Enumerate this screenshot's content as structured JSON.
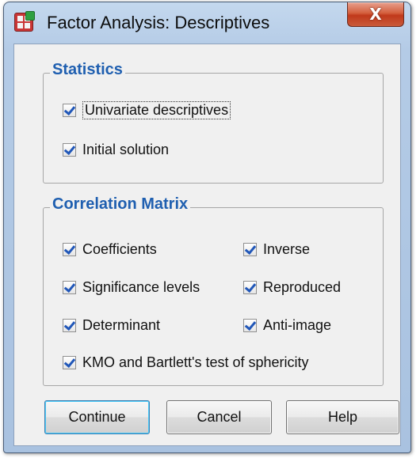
{
  "window": {
    "title": "Factor Analysis: Descriptives",
    "close_label": "X"
  },
  "statistics": {
    "legend": "Statistics",
    "items": [
      {
        "label": "Univariate descriptives",
        "checked": true
      },
      {
        "label": "Initial solution",
        "checked": true
      }
    ]
  },
  "correlation": {
    "legend": "Correlation Matrix",
    "items": [
      {
        "label": "Coefficients",
        "checked": true
      },
      {
        "label": "Inverse",
        "checked": true
      },
      {
        "label": "Significance levels",
        "checked": true
      },
      {
        "label": "Reproduced",
        "checked": true
      },
      {
        "label": "Determinant",
        "checked": true
      },
      {
        "label": "Anti-image",
        "checked": true
      },
      {
        "label": "KMO and Bartlett's test of sphericity",
        "checked": true
      }
    ]
  },
  "buttons": {
    "continue": "Continue",
    "cancel": "Cancel",
    "help": "Help"
  },
  "colors": {
    "accent": "#1f5fb0",
    "check": "#2157b8",
    "close": "#c0391b"
  }
}
